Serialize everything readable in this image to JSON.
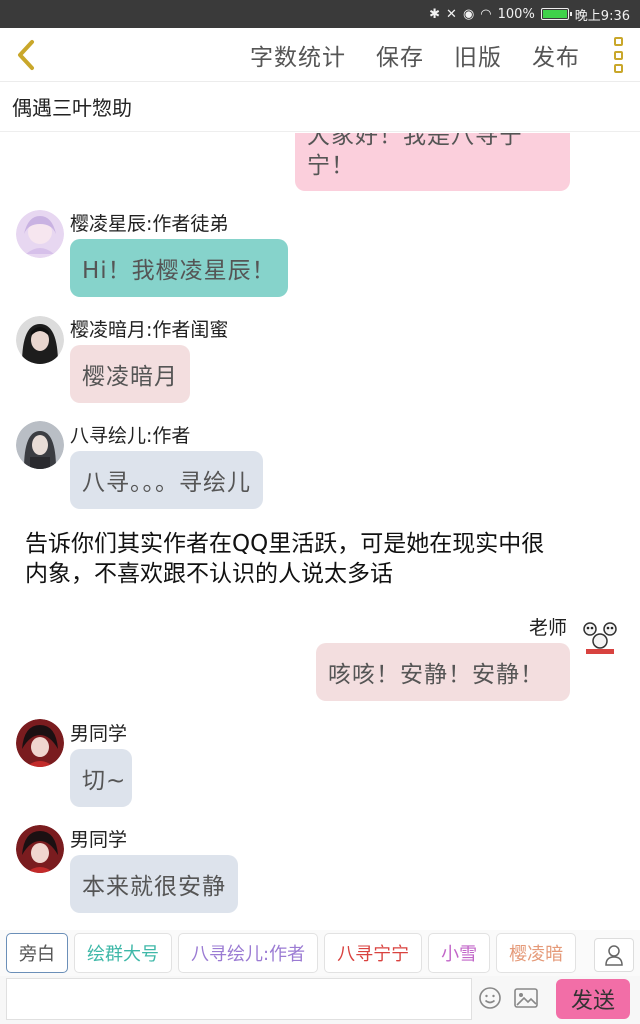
{
  "status_bar": {
    "battery": "100%",
    "time": "晚上9:36",
    "battery_level": 1.0
  },
  "toolbar": {
    "actions": [
      "字数统计",
      "保存",
      "旧版",
      "发布"
    ]
  },
  "title": "偶遇三叶惣助",
  "messages": {
    "top_partial": {
      "text_line1": "大家好！我是八寻宁",
      "text_line2": "宁！",
      "bubble_color": "#fbcfdc"
    },
    "m1": {
      "name": "樱凌星辰:作者徒弟",
      "text": "Hi！我樱凌星辰！",
      "bubble_color": "#86d3cb"
    },
    "m2": {
      "name": "樱凌暗月:作者闺蜜",
      "text": "樱凌暗月",
      "bubble_color": "#f3dedf"
    },
    "m3": {
      "name": "八寻绘儿:作者",
      "text": "八寻。。。寻绘儿",
      "bubble_color": "#dde3ec"
    },
    "narration": {
      "line1": "告诉你们其实作者在QQ里活跃，可是她在现实中很",
      "line2": "内象，不喜欢跟不认识的人说太多话"
    },
    "m4": {
      "name": "老师",
      "text": "咳咳！安静！安静！",
      "bubble_color": "#f3dedf"
    },
    "m5": {
      "name": "男同学",
      "text": "切~",
      "bubble_color": "#dde3ec"
    },
    "m6": {
      "name": "男同学",
      "text": "本来就很安静",
      "bubble_color": "#dde3ec"
    }
  },
  "chips": [
    {
      "label": "旁白",
      "color": "#555555"
    },
    {
      "label": "绘群大号",
      "color": "#3fb8a8"
    },
    {
      "label": "八寻绘儿:作者",
      "color": "#9b7bd3"
    },
    {
      "label": "八寻宁宁",
      "color": "#d9423f"
    },
    {
      "label": "小雪",
      "color": "#c266c8"
    },
    {
      "label": "樱凌暗",
      "color": "#e59a79"
    }
  ],
  "input": {
    "placeholder": "",
    "send_label": "发送"
  },
  "icons": {
    "back": "back-chevron-icon",
    "more": "more-vertical-icon",
    "person": "person-icon",
    "emoji": "smiley-icon",
    "image": "image-icon"
  },
  "colors": {
    "accent_gold": "#c9a72a",
    "send_pink": "#f26ea7"
  }
}
